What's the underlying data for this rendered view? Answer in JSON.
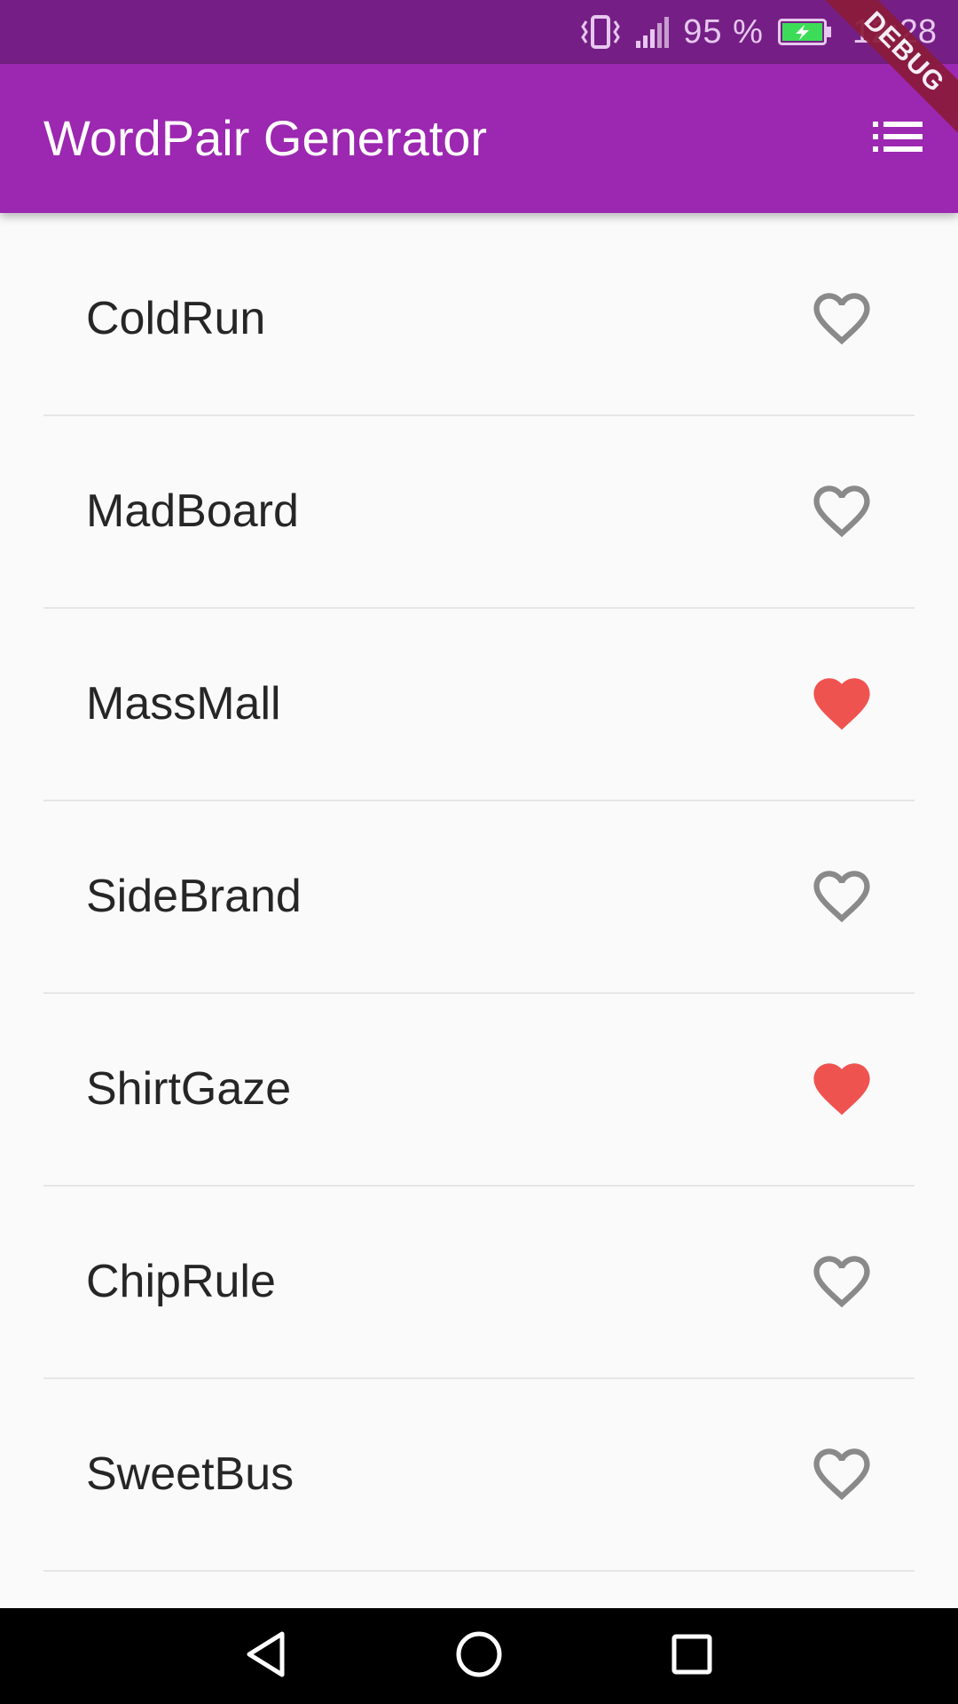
{
  "status_bar": {
    "battery_percent": "95 %",
    "time": "12:28",
    "icons": [
      "vibrate-icon",
      "signal-icon",
      "battery-charging-icon"
    ],
    "battery_color": "#3ddc58"
  },
  "app_bar": {
    "title": "WordPair Generator",
    "menu_icon": "list-icon",
    "color": "#9c27b0"
  },
  "debug_banner": "DEBUG",
  "word_pairs": [
    {
      "text": "ColdRun",
      "saved": false
    },
    {
      "text": "MadBoard",
      "saved": false
    },
    {
      "text": "MassMall",
      "saved": true
    },
    {
      "text": "SideBrand",
      "saved": false
    },
    {
      "text": "ShirtGaze",
      "saved": true
    },
    {
      "text": "ChipRule",
      "saved": false
    },
    {
      "text": "SweetBus",
      "saved": false
    }
  ],
  "colors": {
    "heart_saved": "#ef5350",
    "heart_unsaved": "#8a8a8a"
  },
  "nav_bar": {
    "icons": [
      "back-icon",
      "home-icon",
      "recents-icon"
    ]
  }
}
